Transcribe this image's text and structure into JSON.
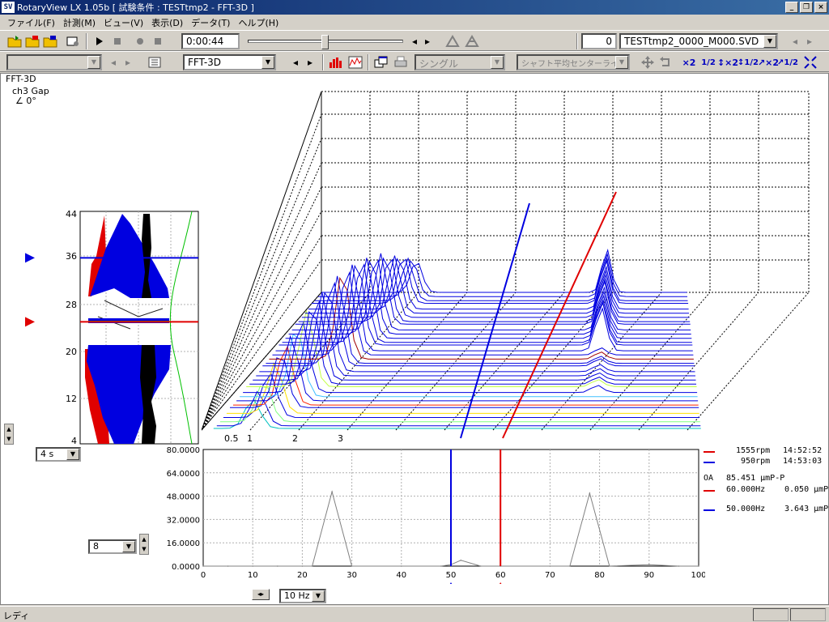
{
  "window": {
    "title": "RotaryView LX 1.05b [ 試験条件 : TESTtmp2 - FFT-3D ]",
    "app_icon": "SV",
    "controls": [
      "_",
      "❐",
      "×"
    ]
  },
  "menu": [
    "ファイル(F)",
    "計測(M)",
    "ビュー(V)",
    "表示(D)",
    "データ(T)",
    "ヘルプ(H)"
  ],
  "toolbar1": {
    "time": "0:00:44",
    "counter": "0",
    "file": "TESTtmp2_0000_M000.SVD",
    "slider_fraction": 0.5
  },
  "toolbar2": {
    "left_combo": "",
    "view_combo": "FFT-3D",
    "mode_combo": "シングル",
    "line_combo": "シャフト平均センターライン",
    "scale_buttons": [
      "×2",
      "1/2",
      "↕×2",
      "↕1/2",
      "↗×2",
      "↗1/2"
    ]
  },
  "plot_info": {
    "name": "FFT-3D",
    "channel": "ch3  Gap",
    "angle": "∠  0°"
  },
  "side_plot": {
    "y_ticks": [
      "44",
      "36",
      "28",
      "20",
      "12",
      "4"
    ],
    "marker_blue_value": 36,
    "marker_red_value": 25
  },
  "left_controls": {
    "time_combo": "4 s",
    "count_combo": "8"
  },
  "waterfall_axis": [
    "0.5",
    "1",
    "2",
    "3"
  ],
  "spectrum": {
    "y_ticks": [
      "80.0000",
      "64.0000",
      "48.0000",
      "32.0000",
      "16.0000",
      "0.0000"
    ],
    "x_ticks": [
      "0",
      "10",
      "20",
      "30",
      "40",
      "50",
      "60",
      "70",
      "80",
      "90",
      "100"
    ],
    "cursor_blue_hz": 50,
    "cursor_red_hz": 60,
    "freq_combo": "10 Hz"
  },
  "legend": {
    "rows": [
      {
        "color": "#e00000",
        "rpm": "1555rpm",
        "time": "14:52:52"
      },
      {
        "color": "#0000e0",
        "rpm": "950rpm",
        "time": "14:53:03"
      }
    ],
    "oa_label": "OA",
    "oa_value": "85.451 μmP-P",
    "values": [
      {
        "color": "#e00000",
        "freq": "60.000Hz",
        "amp": "0.050 μmP"
      },
      {
        "color": "#0000e0",
        "freq": "50.000Hz",
        "amp": "3.643 μmP"
      }
    ]
  },
  "status": {
    "text": "レディ"
  },
  "colors": {
    "blue": "#0000e0",
    "red": "#e00000",
    "navy": "#0a246a"
  },
  "chart_data": {
    "type": "line",
    "x": [
      0,
      5,
      10,
      15,
      20,
      22,
      26,
      30,
      40,
      48,
      50,
      52,
      56,
      60,
      70,
      74,
      78,
      82,
      90,
      96,
      100
    ],
    "series": [
      {
        "values": [
          0,
          0,
          0,
          0,
          0,
          0,
          51,
          0,
          0,
          0,
          1,
          4,
          0,
          0,
          0,
          0,
          50,
          0,
          1,
          0,
          0
        ]
      }
    ],
    "xlim": [
      0,
      100
    ],
    "ylim": [
      0,
      80
    ],
    "grid": true
  }
}
